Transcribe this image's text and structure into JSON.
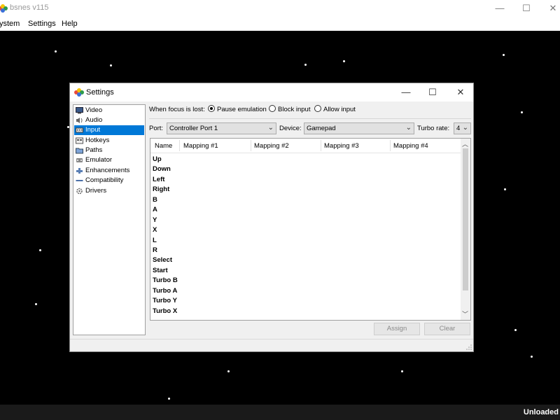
{
  "main_window": {
    "title": "bsnes v115",
    "controls": {
      "minimize": "—",
      "maximize": "☐",
      "close": "✕"
    },
    "menu": [
      "ystem",
      "Settings",
      "Help"
    ],
    "status": "Unloaded"
  },
  "dialog": {
    "title": "Settings",
    "controls": {
      "minimize": "—",
      "maximize": "☐",
      "close": "✕"
    },
    "sidebar": [
      {
        "label": "Video",
        "icon": "monitor-icon"
      },
      {
        "label": "Audio",
        "icon": "speaker-icon"
      },
      {
        "label": "Input",
        "icon": "keyboard-icon",
        "selected": true
      },
      {
        "label": "Hotkeys",
        "icon": "hotkey-icon"
      },
      {
        "label": "Paths",
        "icon": "folder-icon"
      },
      {
        "label": "Emulator",
        "icon": "emulator-icon"
      },
      {
        "label": "Enhancements",
        "icon": "puzzle-icon"
      },
      {
        "label": "Compatibility",
        "icon": "compat-icon"
      },
      {
        "label": "Drivers",
        "icon": "gear-icon"
      }
    ],
    "focus": {
      "label": "When focus is lost:",
      "options": [
        "Pause emulation",
        "Block input",
        "Allow input"
      ],
      "selected": "Pause emulation"
    },
    "port": {
      "port_label": "Port:",
      "port_value": "Controller Port 1",
      "device_label": "Device:",
      "device_value": "Gamepad",
      "turbo_label": "Turbo rate:",
      "turbo_value": "4"
    },
    "table": {
      "headers": [
        "Name",
        "Mapping #1",
        "Mapping #2",
        "Mapping #3",
        "Mapping #4"
      ],
      "rows": [
        "Up",
        "Down",
        "Left",
        "Right",
        "B",
        "A",
        "Y",
        "X",
        "L",
        "R",
        "Select",
        "Start",
        "Turbo B",
        "Turbo A",
        "Turbo Y",
        "Turbo X"
      ]
    },
    "buttons": {
      "assign": "Assign",
      "clear": "Clear"
    }
  },
  "colors": {
    "selection": "#0078d7",
    "background": "#000000",
    "dialog": "#f0f0f0"
  }
}
